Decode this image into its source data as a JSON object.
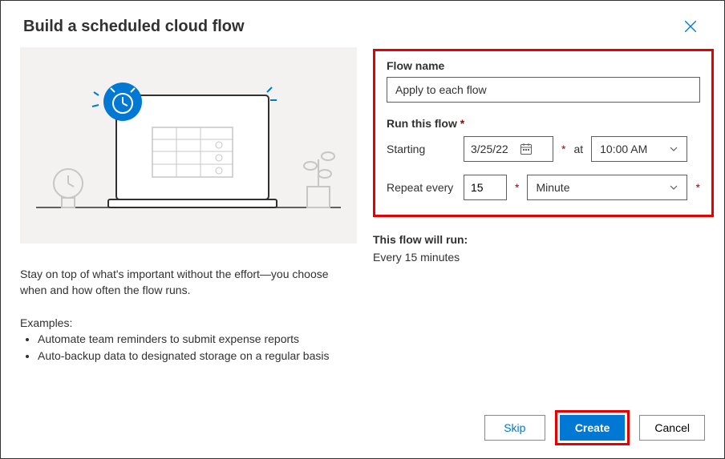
{
  "dialog": {
    "title": "Build a scheduled cloud flow",
    "close_label": "Close"
  },
  "left": {
    "description": "Stay on top of what's important without the effort—you choose when and how often the flow runs.",
    "examples_label": "Examples:",
    "examples": [
      "Automate team reminders to submit expense reports",
      "Auto-backup data to designated storage on a regular basis"
    ]
  },
  "form": {
    "flow_name_label": "Flow name",
    "flow_name_value": "Apply to each flow",
    "run_label": "Run this flow",
    "starting_label": "Starting",
    "starting_date": "3/25/22",
    "at_label": "at",
    "starting_time": "10:00 AM",
    "repeat_label": "Repeat every",
    "repeat_value": "15",
    "repeat_unit": "Minute",
    "required_mark": "*"
  },
  "summary": {
    "label": "This flow will run:",
    "text": "Every 15 minutes"
  },
  "footer": {
    "skip": "Skip",
    "create": "Create",
    "cancel": "Cancel"
  },
  "colors": {
    "primary": "#0078d4",
    "highlight": "#e60000"
  }
}
